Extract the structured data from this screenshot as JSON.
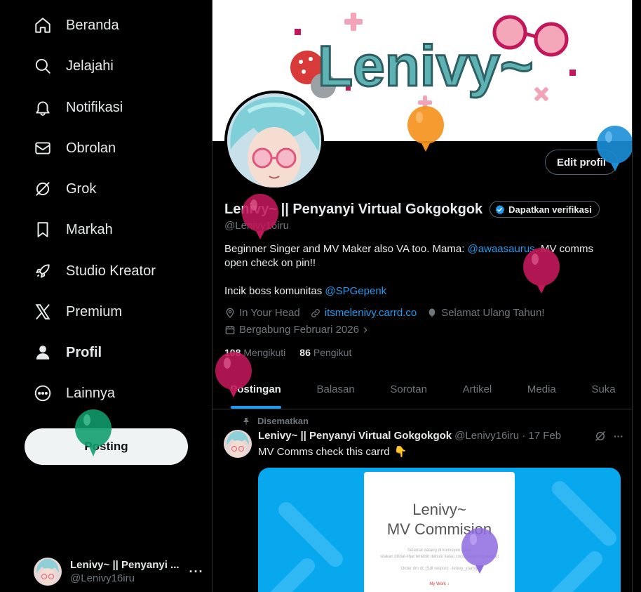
{
  "sidebar": {
    "items": [
      {
        "label": "Beranda",
        "icon": "home-icon"
      },
      {
        "label": "Jelajahi",
        "icon": "search-icon"
      },
      {
        "label": "Notifikasi",
        "icon": "bell-icon"
      },
      {
        "label": "Obrolan",
        "icon": "mail-icon"
      },
      {
        "label": "Grok",
        "icon": "grok-icon"
      },
      {
        "label": "Markah",
        "icon": "bookmark-icon"
      },
      {
        "label": "Studio Kreator",
        "icon": "rocket-icon"
      },
      {
        "label": "Premium",
        "icon": "x-logo-icon"
      },
      {
        "label": "Profil",
        "icon": "person-icon",
        "active": true
      },
      {
        "label": "Lainnya",
        "icon": "more-circle-icon"
      }
    ],
    "post_label": "Posting",
    "account": {
      "name": "Lenivy~ || Penyanyi ...",
      "handle": "@Lenivy16iru",
      "more": "···"
    }
  },
  "profile": {
    "edit_label": "Edit profil",
    "display_name": "Lenivy~ || Penyanyi Virtual Gokgokgok",
    "verify_label": "Dapatkan verifikasi",
    "handle": "@Lenivy16iru",
    "bio": {
      "line1_pre": "Beginner Singer and MV Maker also VA too. Mama: ",
      "line1_link": "@awaasaurus",
      "line1_post": ". MV comms",
      "line2": "open check on pin!!",
      "line3_pre": "Incik boss komunitas ",
      "line3_link": "@SPGepenk"
    },
    "location": "In Your Head",
    "website": "itsmelenivy.carrd.co",
    "birthday": "Selamat Ulang Tahun!",
    "joined": "Bergabung Februari 2026",
    "joined_chevron": "›",
    "following_count": "108",
    "following_label": "Mengikuti",
    "followers_count": "86",
    "followers_label": "Pengikut"
  },
  "tabs": [
    "Postingan",
    "Balasan",
    "Sorotan",
    "Artikel",
    "Media",
    "Suka"
  ],
  "tweet": {
    "pinned_label": "Disematkan",
    "name": "Lenivy~ || Penyanyi Virtual Gokgokgok",
    "handle_time": "@Lenivy16iru · 17 Feb",
    "more": "···",
    "text": "MV Comms check this carrd",
    "emoji": "👇",
    "card": {
      "title_line1": "Lenivy~",
      "title_line2": "MV Commision",
      "small_line1": "Selamat datang di komisyen saya!",
      "small_line2": "silakan dilihat-lihat terlebih dahulu kalau cocok langsung angkut",
      "small_line3": "Order dm dc (Sdt respon) - lenivy_yrarivy",
      "link": "My Work ↓"
    }
  },
  "banner_logo": "Lenivy~",
  "colors": {
    "accent": "#1d9bf0",
    "background": "#000000",
    "muted": "#71767b",
    "border": "#2f3336",
    "banner_text": "#4a9ea0",
    "card_bg": "#08a8ef"
  }
}
